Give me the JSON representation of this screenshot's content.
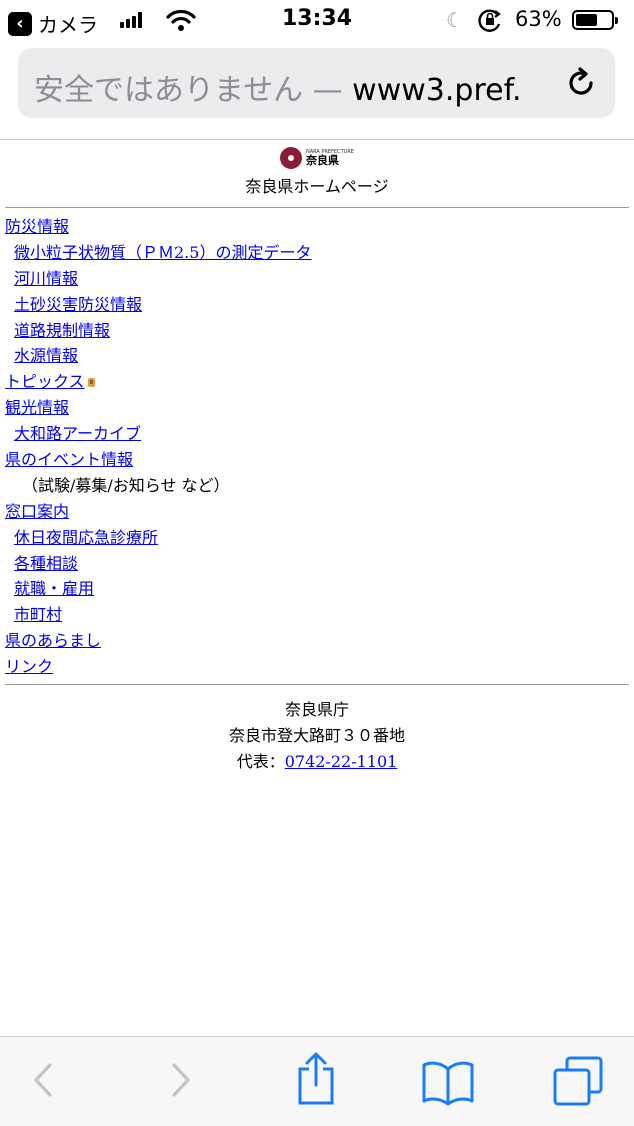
{
  "status_bar": {
    "back_app_label": "カメラ",
    "time": "13:34",
    "battery_percent": "63%",
    "battery_level": 0.63
  },
  "address_bar": {
    "insecure_label": "安全ではありません —",
    "url": " www3.pref."
  },
  "header": {
    "logo_small": "NARA PREFECTURE",
    "logo_name": "奈良県",
    "site_title": "奈良県ホームページ"
  },
  "menu": [
    {
      "label": "防災情報",
      "kind": "link"
    },
    {
      "label": "微小粒子状物質（ＰＭ2.5）の測定データ",
      "kind": "sub"
    },
    {
      "label": "河川情報",
      "kind": "sub"
    },
    {
      "label": "土砂災害防災情報",
      "kind": "sub"
    },
    {
      "label": "道路規制情報",
      "kind": "sub"
    },
    {
      "label": "水源情報",
      "kind": "sub"
    },
    {
      "label": "トピックス",
      "kind": "link"
    },
    {
      "label": "観光情報",
      "kind": "link"
    },
    {
      "label": "大和路アーカイブ",
      "kind": "sub"
    },
    {
      "label": "県のイベント情報",
      "kind": "link"
    },
    {
      "label": "（試験/募集/お知らせ など）",
      "kind": "note"
    },
    {
      "label": "窓口案内",
      "kind": "link"
    },
    {
      "label": "休日夜間応急診療所",
      "kind": "sub"
    },
    {
      "label": "各種相談",
      "kind": "sub"
    },
    {
      "label": "就職・雇用",
      "kind": "sub"
    },
    {
      "label": "市町村",
      "kind": "sub"
    },
    {
      "label": "県のあらまし",
      "kind": "link"
    },
    {
      "label": "リンク",
      "kind": "link"
    }
  ],
  "footer": {
    "office": "奈良県庁",
    "address": "奈良市登大路町３０番地",
    "phone_label": "代表：",
    "phone": "0742-22-1101"
  },
  "toolbar": {
    "icons": [
      "back-arrow-icon",
      "forward-arrow-icon",
      "share-icon",
      "bookmarks-icon",
      "tabs-icon"
    ]
  },
  "colors": {
    "link": "#0000ee",
    "ios_blue": "#1a7cf7",
    "logo": "#8b1c36"
  }
}
